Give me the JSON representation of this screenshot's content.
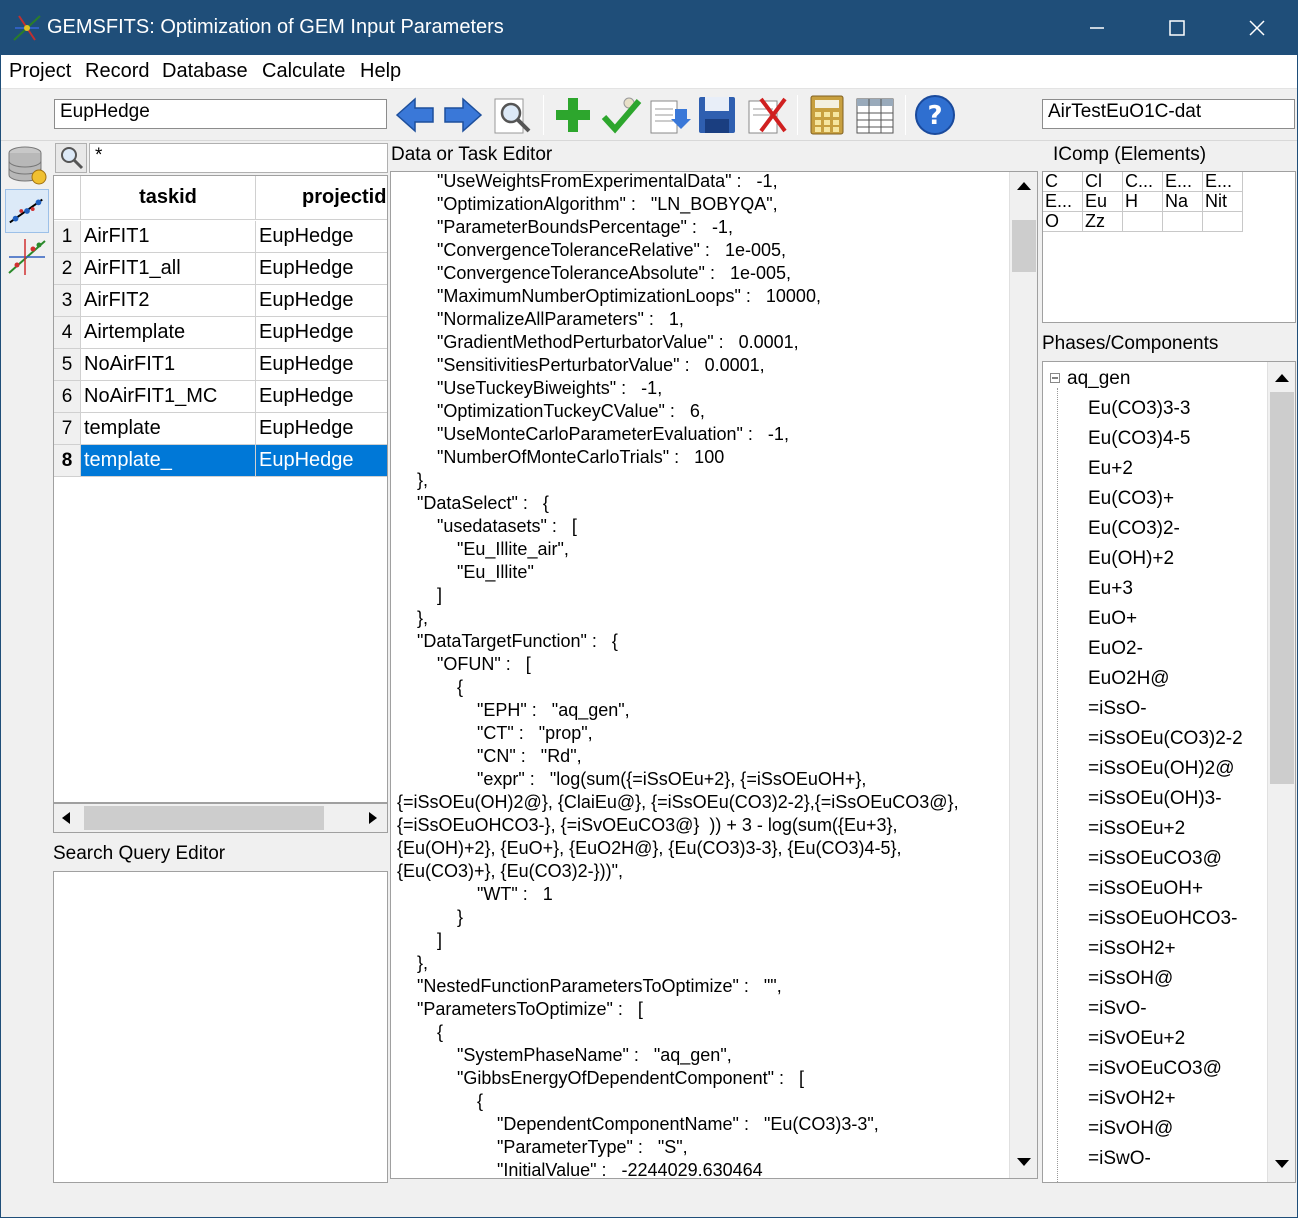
{
  "window": {
    "title": "GEMSFITS: Optimization of GEM Input Parameters"
  },
  "menu": [
    "Project",
    "Record",
    "Database",
    "Calculate",
    "Help"
  ],
  "toolbar": {
    "project_field": "EupHedge",
    "record_field": "AirTestEuO1C-dat",
    "icons": [
      "arrow-left-icon",
      "arrow-right-icon",
      "search-icon",
      "add-icon",
      "check-icon",
      "update-icon",
      "save-icon",
      "delete-icon",
      "calculator-icon",
      "table-icon",
      "help-icon"
    ]
  },
  "sidebar": {
    "icons": [
      "database-icon",
      "task-edit-icon",
      "fit-plot-icon"
    ]
  },
  "query_filter": "*",
  "table": {
    "columns": [
      "taskid",
      "projectid"
    ],
    "rows": [
      {
        "n": "1",
        "taskid": "AirFIT1",
        "projectid": "EupHedge"
      },
      {
        "n": "2",
        "taskid": "AirFIT1_all",
        "projectid": "EupHedge"
      },
      {
        "n": "3",
        "taskid": "AirFIT2",
        "projectid": "EupHedge"
      },
      {
        "n": "4",
        "taskid": "Airtemplate",
        "projectid": "EupHedge"
      },
      {
        "n": "5",
        "taskid": "NoAirFIT1",
        "projectid": "EupHedge"
      },
      {
        "n": "6",
        "taskid": "NoAirFIT1_MC",
        "projectid": "EupHedge"
      },
      {
        "n": "7",
        "taskid": "template",
        "projectid": "EupHedge"
      },
      {
        "n": "8",
        "taskid": "template_",
        "projectid": "EupHedge"
      }
    ],
    "selected_row": 8
  },
  "search_query_editor": {
    "label": "Search Query Editor",
    "text": ""
  },
  "editor": {
    "label": "Data or Task Editor",
    "lines": [
      "        \"UseWeightsFromExperimentalData\" :   -1,",
      "        \"OptimizationAlgorithm\" :   \"LN_BOBYQA\",",
      "        \"ParameterBoundsPercentage\" :   -1,",
      "        \"ConvergenceToleranceRelative\" :   1e-005,",
      "        \"ConvergenceToleranceAbsolute\" :   1e-005,",
      "        \"MaximumNumberOptimizationLoops\" :   10000,",
      "        \"NormalizeAllParameters\" :   1,",
      "        \"GradientMethodPerturbatorValue\" :   0.0001,",
      "        \"SensitivitiesPerturbatorValue\" :   0.0001,",
      "        \"UseTuckeyBiweights\" :   -1,",
      "        \"OptimizationTuckeyCValue\" :   6,",
      "        \"UseMonteCarloParameterEvaluation\" :   -1,",
      "        \"NumberOfMonteCarloTrials\" :   100",
      "    },",
      "    \"DataSelect\" :   {",
      "        \"usedatasets\" :   [",
      "            \"Eu_Illite_air\",",
      "            \"Eu_Illite\"",
      "        ]",
      "    },",
      "    \"DataTargetFunction\" :   {",
      "        \"OFUN\" :   [",
      "            {",
      "                \"EPH\" :   \"aq_gen\",",
      "                \"CT\" :   \"prop\",",
      "                \"CN\" :   \"Rd\",",
      "                \"expr\" :   \"log(sum({=iSsOEu+2}, {=iSsOEuOH+},",
      "{=iSsOEu(OH)2@}, {ClaiEu@}, {=iSsOEu(CO3)2-2},{=iSsOEuCO3@},",
      "{=iSsOEuOHCO3-}, {=iSvOEuCO3@}  )) + 3 - log(sum({Eu+3},",
      "{Eu(OH)+2}, {EuO+}, {EuO2H@}, {Eu(CO3)3-3}, {Eu(CO3)4-5},",
      "{Eu(CO3)+}, {Eu(CO3)2-}))\",",
      "                \"WT\" :   1",
      "            }",
      "        ]",
      "    },",
      "    \"NestedFunctionParametersToOptimize\" :   \"\",",
      "    \"ParametersToOptimize\" :   [",
      "        {",
      "            \"SystemPhaseName\" :   \"aq_gen\",",
      "            \"GibbsEnergyOfDependentComponent\" :   [",
      "                {",
      "                    \"DependentComponentName\" :   \"Eu(CO3)3-3\",",
      "                    \"ParameterType\" :   \"S\",",
      "                    \"InitialValue\" :   -2244029.630464",
      "                },"
    ]
  },
  "icomp": {
    "label": "IComp (Elements)",
    "rows": [
      [
        "C",
        "Cl",
        "C...",
        "E...",
        "E..."
      ],
      [
        "E...",
        "Eu",
        "H",
        "Na",
        "Nit"
      ],
      [
        "O",
        "Zz",
        "",
        "",
        ""
      ]
    ]
  },
  "phases": {
    "label": "Phases/Components",
    "root": "aq_gen",
    "items": [
      "Eu(CO3)3-3",
      "Eu(CO3)4-5",
      "Eu+2",
      "Eu(CO3)+",
      "Eu(CO3)2-",
      "Eu(OH)+2",
      "Eu+3",
      "EuO+",
      "EuO2-",
      "EuO2H@",
      "=iSsO-",
      "=iSsOEu(CO3)2-2",
      "=iSsOEu(OH)2@",
      "=iSsOEu(OH)3-",
      "=iSsOEu+2",
      "=iSsOEuCO3@",
      "=iSsOEuOH+",
      "=iSsOEuOHCO3-",
      "=iSsOH2+",
      "=iSsOH@",
      "=iSvO-",
      "=iSvOEu+2",
      "=iSvOEuCO3@",
      "=iSvOH2+",
      "=iSvOH@",
      "=iSwO-"
    ]
  },
  "colors": {
    "titlebar": "#1f4e79",
    "selection": "#0078d7"
  }
}
